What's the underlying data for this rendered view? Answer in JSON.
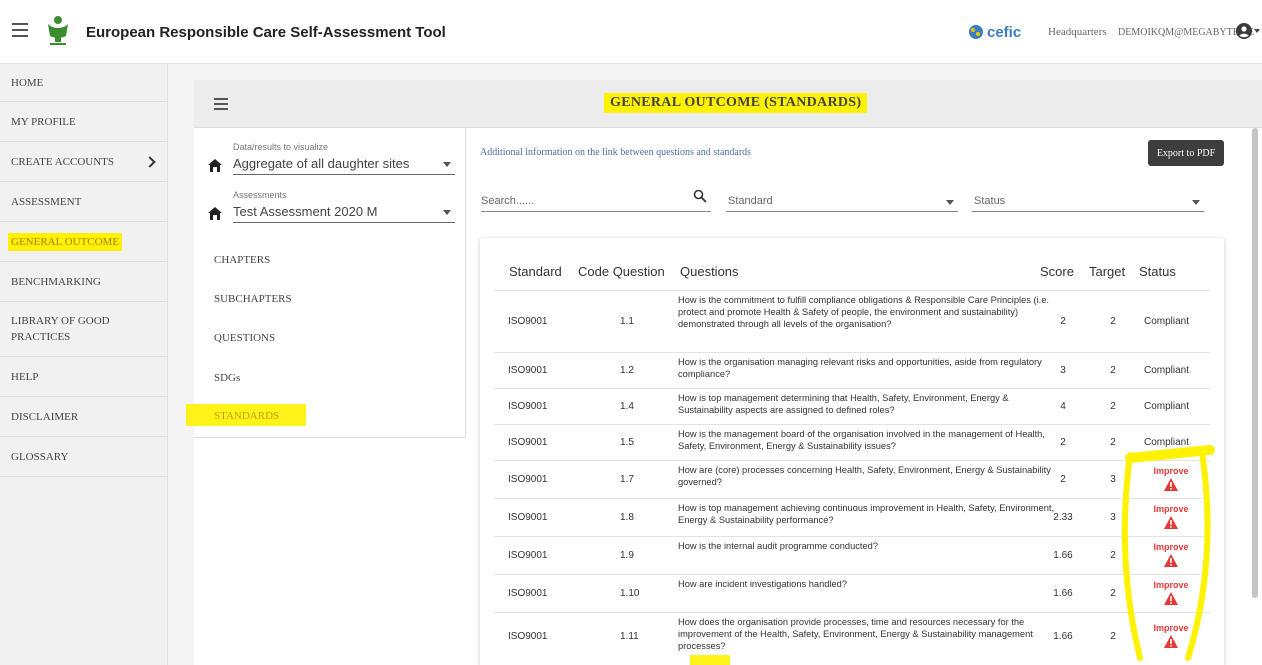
{
  "app": {
    "title": "European Responsible Care Self-Assessment Tool",
    "brand": "cefic",
    "location": "Headquarters",
    "user_email": "DEMOIKQM@MEGABYTE.BE"
  },
  "sidebar": {
    "items": [
      {
        "label": "HOME"
      },
      {
        "label": "MY PROFILE"
      },
      {
        "label": "CREATE ACCOUNTS"
      },
      {
        "label": "ASSESSMENT"
      },
      {
        "label": "GENERAL OUTCOME"
      },
      {
        "label": "BENCHMARKING"
      },
      {
        "label": "LIBRARY OF GOOD PRACTICES"
      },
      {
        "label": "HELP"
      },
      {
        "label": "DISCLAIMER"
      },
      {
        "label": "GLOSSARY"
      }
    ]
  },
  "page": {
    "title": "GENERAL OUTCOME (STANDARDS)"
  },
  "filters": {
    "data_label": "Data/results to visualize",
    "data_value": "Aggregate of all daughter sites",
    "assess_label": "Assessments",
    "assess_value": "Test Assessment 2020 M",
    "links": [
      "CHAPTERS",
      "SUBCHAPTERS",
      "QUESTIONS",
      "SDGs",
      "STANDARDS"
    ]
  },
  "main": {
    "additional_info": "Additional information on the link between questions and standards",
    "export_label": "Export to PDF",
    "search_placeholder": "Search......",
    "standard_dropdown": "Standard",
    "status_dropdown": "Status"
  },
  "table": {
    "headers": [
      "Standard",
      "Code Question",
      "Questions",
      "Score",
      "Target",
      "Status"
    ],
    "rows": [
      {
        "standard": "ISO9001",
        "code": "1.1",
        "question": "How is the commitment to fulfill compliance obligations & Responsible Care Principles (i.e. protect and promote Health & Safety of people, the environment and sustainability) demonstrated through all levels of the organisation?",
        "score": "2",
        "target": "2",
        "status": "Compliant"
      },
      {
        "standard": "ISO9001",
        "code": "1.2",
        "question": "How is the organisation managing relevant risks and opportunities, aside from regulatory compliance?",
        "score": "3",
        "target": "2",
        "status": "Compliant"
      },
      {
        "standard": "ISO9001",
        "code": "1.4",
        "question": "How is top management determining that Health, Safety, Environment, Energy & Sustainability aspects are assigned to defined roles?",
        "score": "4",
        "target": "2",
        "status": "Compliant"
      },
      {
        "standard": "ISO9001",
        "code": "1.5",
        "question": "How is the management board of the organisation involved in the management of Health, Safety, Environment, Energy & Sustainability issues?",
        "score": "2",
        "target": "2",
        "status": "Compliant"
      },
      {
        "standard": "ISO9001",
        "code": "1.7",
        "question": "How are (core) processes concerning Health, Safety, Environment, Energy & Sustainability governed?",
        "score": "2",
        "target": "3",
        "status": "Improve"
      },
      {
        "standard": "ISO9001",
        "code": "1.8",
        "question": "How is top management achieving continuous improvement in Health, Safety, Environment, Energy & Sustainability performance?",
        "score": "2.33",
        "target": "3",
        "status": "Improve"
      },
      {
        "standard": "ISO9001",
        "code": "1.9",
        "question": "How is the internal audit programme conducted?",
        "score": "1.66",
        "target": "2",
        "status": "Improve"
      },
      {
        "standard": "ISO9001",
        "code": "1.10",
        "question": "How are incident investigations handled?",
        "score": "1.66",
        "target": "2",
        "status": "Improve"
      },
      {
        "standard": "ISO9001",
        "code": "1.11",
        "question": "How does the organisation provide processes, time and resources necessary for the improvement of the Health, Safety, Environment, Energy & Sustainability management processes?",
        "score": "1.66",
        "target": "2",
        "status": "Improve"
      }
    ]
  },
  "colors": {
    "highlight": "#fff200",
    "improve": "#e53935",
    "brand_blue": "#3a7fc0"
  }
}
